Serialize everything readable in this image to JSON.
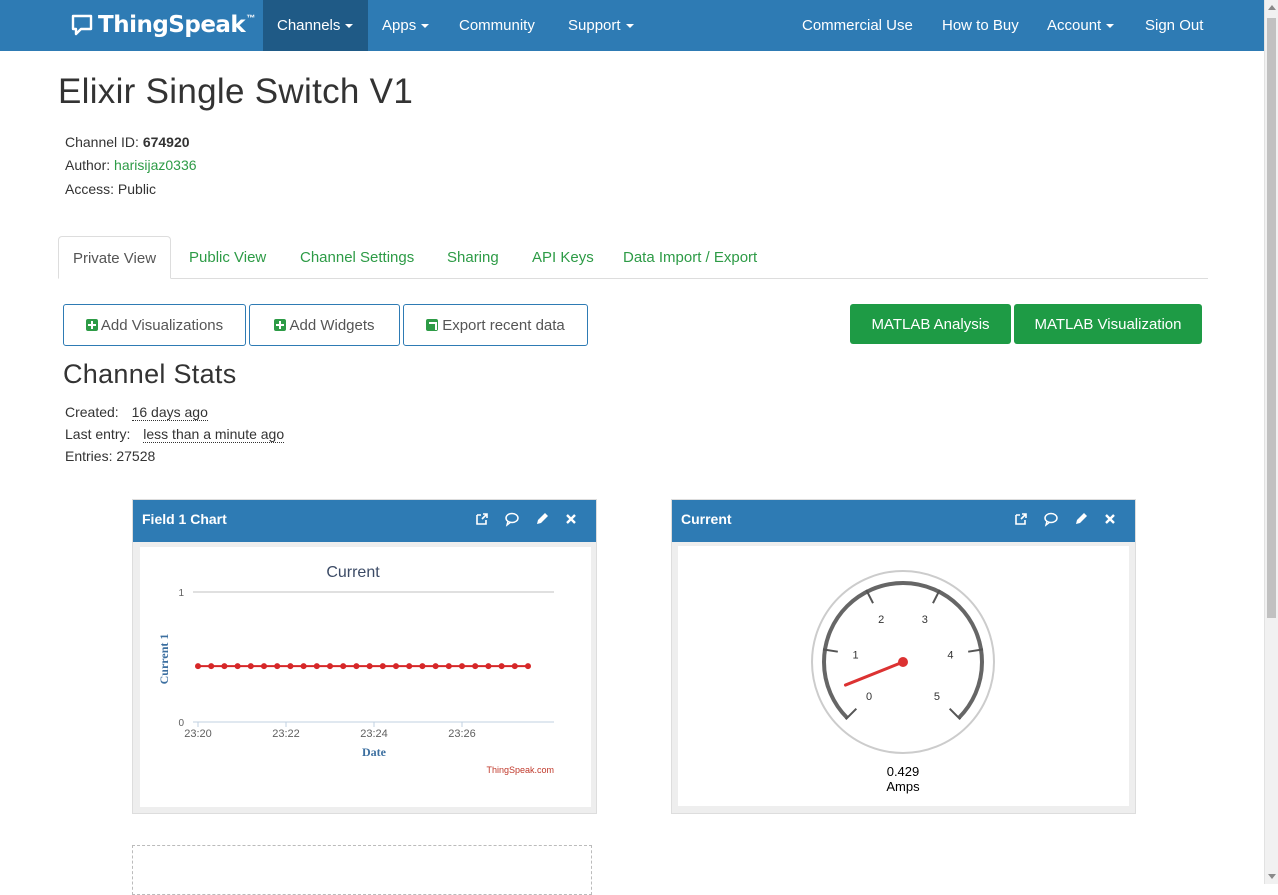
{
  "nav": {
    "brand": "ThingSpeak",
    "brand_tm": "™",
    "channels": "Channels",
    "apps": "Apps",
    "community": "Community",
    "support": "Support",
    "commercial": "Commercial Use",
    "how_to_buy": "How to Buy",
    "account": "Account",
    "sign_out": "Sign Out"
  },
  "channel": {
    "title": "Elixir Single Switch V1",
    "id_label": "Channel ID:",
    "id_value": "674920",
    "author_label": "Author:",
    "author_value": "harisijaz0336",
    "access_label": "Access:",
    "access_value": "Public"
  },
  "tabs": [
    "Private View",
    "Public View",
    "Channel Settings",
    "Sharing",
    "API Keys",
    "Data Import / Export"
  ],
  "buttons": {
    "add_viz": "Add Visualizations",
    "add_widgets": "Add Widgets",
    "export": "Export recent data",
    "matlab_analysis": "MATLAB Analysis",
    "matlab_viz": "MATLAB Visualization"
  },
  "stats": {
    "title": "Channel Stats",
    "created_label": "Created:",
    "created_value": "16 days ago",
    "last_label": "Last entry:",
    "last_value": "less than a minute ago",
    "entries_label": "Entries:",
    "entries_value": "27528"
  },
  "widgets": {
    "chart_title": "Field 1 Chart",
    "gauge_title": "Current"
  },
  "colors": {
    "navbar": "#2e7bb4",
    "green": "#1e9b45",
    "series": "#d62728"
  },
  "chart_data": [
    {
      "type": "line",
      "title": "Current",
      "xlabel": "Date",
      "ylabel": "Current 1",
      "ylim": [
        0,
        1
      ],
      "yticks": [
        "0",
        "1"
      ],
      "xticks": [
        "23:20",
        "23:22",
        "23:24",
        "23:26"
      ],
      "x": [
        "23:20:00",
        "23:20:18",
        "23:20:36",
        "23:20:54",
        "23:21:12",
        "23:21:30",
        "23:21:48",
        "23:22:06",
        "23:22:24",
        "23:22:42",
        "23:23:00",
        "23:23:18",
        "23:23:36",
        "23:23:54",
        "23:24:12",
        "23:24:30",
        "23:24:48",
        "23:25:06",
        "23:25:24",
        "23:25:42",
        "23:26:00",
        "23:26:18",
        "23:26:36",
        "23:26:54",
        "23:27:12",
        "23:27:30"
      ],
      "series": [
        {
          "values": [
            0.43,
            0.43,
            0.43,
            0.43,
            0.43,
            0.43,
            0.43,
            0.43,
            0.43,
            0.43,
            0.43,
            0.43,
            0.43,
            0.43,
            0.43,
            0.43,
            0.43,
            0.43,
            0.43,
            0.43,
            0.43,
            0.43,
            0.43,
            0.43,
            0.43,
            0.43
          ]
        }
      ],
      "credit": "ThingSpeak.com",
      "grid": true
    },
    {
      "type": "gauge",
      "min": 0,
      "max": 5,
      "ticks": [
        "0",
        "1",
        "2",
        "3",
        "4",
        "5"
      ],
      "value": 0.429,
      "value_label": "0.429",
      "units": "Amps"
    }
  ]
}
